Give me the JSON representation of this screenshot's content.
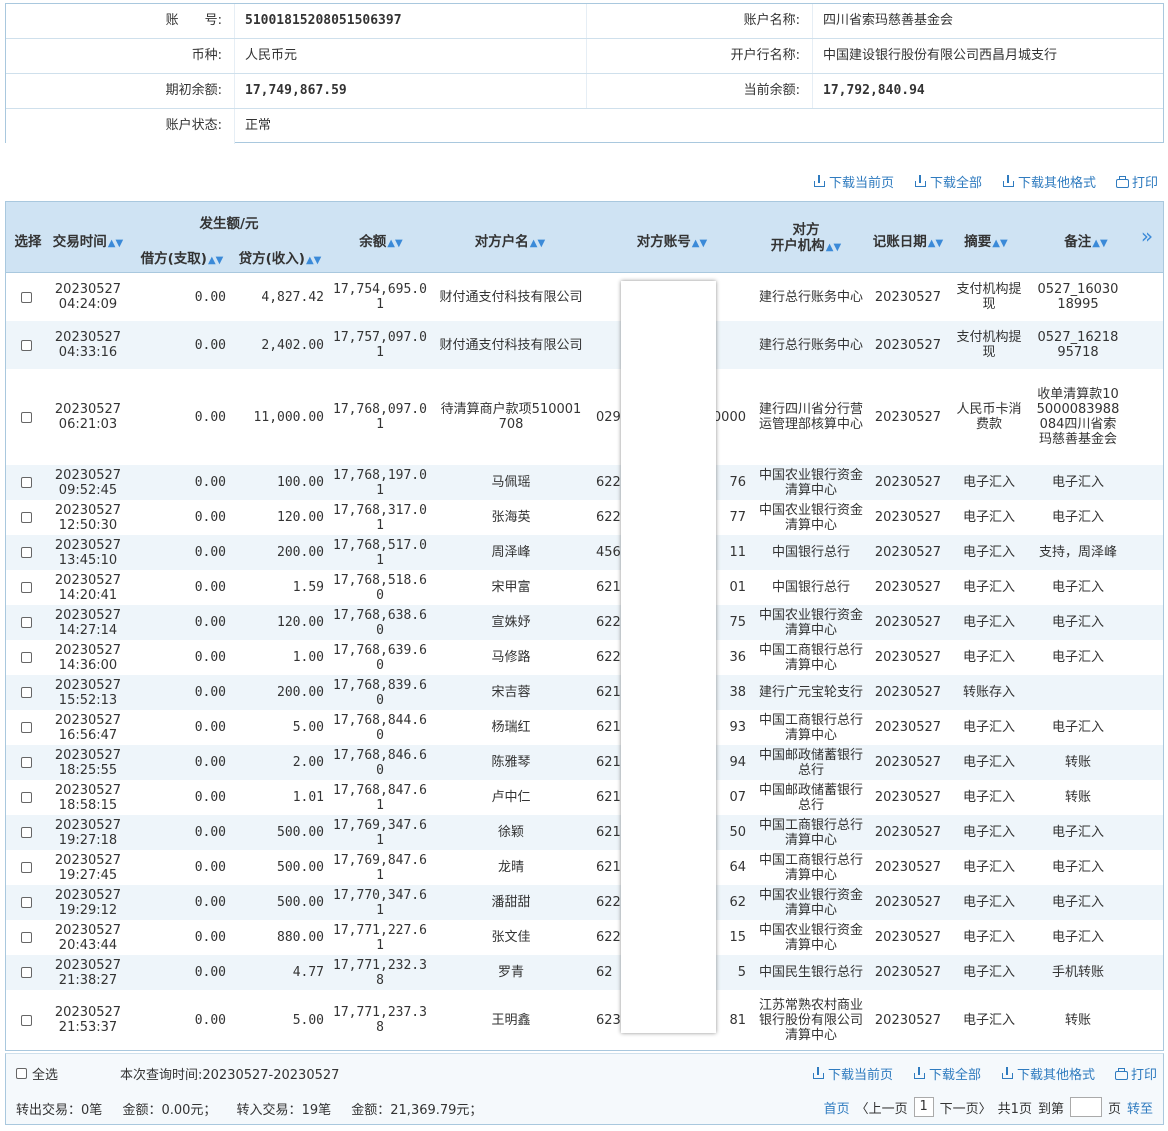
{
  "account": {
    "account_no_label": "账　　号:",
    "account_no": "51001815208051506397",
    "account_name_label": "账户名称:",
    "account_name": "四川省索玛慈善基金会",
    "currency_label": "币种:",
    "currency": "人民币元",
    "bank_label": "开户行名称:",
    "bank": "中国建设银行股份有限公司西昌月城支行",
    "opening_balance_label": "期初余额:",
    "opening_balance": "17,749,867.59",
    "current_balance_label": "当前余额:",
    "current_balance": "17,792,840.94",
    "status_label": "账户状态:",
    "status": "正常"
  },
  "toolbar": {
    "download_page": "下载当前页",
    "download_all": "下载全部",
    "download_other": "下载其他格式",
    "print": "打印"
  },
  "table": {
    "headers": {
      "select": "选择",
      "time": "交易时间",
      "amount_group": "发生额/元",
      "debit": "借方(支取)",
      "credit": "贷方(收入)",
      "balance": "余额",
      "counterparty_name": "对方户名",
      "counterparty_account": "对方账号",
      "counterparty_bank_l1": "对方",
      "counterparty_bank_l2": "开户机构",
      "post_date": "记账日期",
      "summary": "摘要",
      "remark": "备注",
      "more": "»"
    },
    "rows": [
      {
        "date": "20230527",
        "time": "04:24:09",
        "debit": "0.00",
        "credit": "4,827.42",
        "balance": "17,754,695.01",
        "name": "财付通支付科技有限公司",
        "acct_l": "",
        "acct_r": "",
        "bank": "建行总行账务中心",
        "post": "20230527",
        "summary": "支付机构提现",
        "remark": "0527_1603018995"
      },
      {
        "date": "20230527",
        "time": "04:33:16",
        "debit": "0.00",
        "credit": "2,402.00",
        "balance": "17,757,097.01",
        "name": "财付通支付科技有限公司",
        "acct_l": "",
        "acct_r": "",
        "bank": "建行总行账务中心",
        "post": "20230527",
        "summary": "支付机构提现",
        "remark": "0527_1621895718"
      },
      {
        "date": "20230527",
        "time": "06:21:03",
        "debit": "0.00",
        "credit": "11,000.00",
        "balance": "17,768,097.01",
        "name": "待清算商户款项510001708",
        "acct_l": "029",
        "acct_r": "0000",
        "bank": "建行四川省分行营运管理部核算中心",
        "post": "20230527",
        "summary": "人民币卡消费款",
        "remark": "收单清算款105000083988084四川省索玛慈善基金会"
      },
      {
        "date": "20230527",
        "time": "09:52:45",
        "debit": "0.00",
        "credit": "100.00",
        "balance": "17,768,197.01",
        "name": "马佩瑶",
        "acct_l": "6228",
        "acct_r": "76",
        "bank": "中国农业银行资金清算中心",
        "post": "20230527",
        "summary": "电子汇入",
        "remark": "电子汇入"
      },
      {
        "date": "20230527",
        "time": "12:50:30",
        "debit": "0.00",
        "credit": "120.00",
        "balance": "17,768,317.01",
        "name": "张海英",
        "acct_l": "6228",
        "acct_r": "77",
        "bank": "中国农业银行资金清算中心",
        "post": "20230527",
        "summary": "电子汇入",
        "remark": "电子汇入"
      },
      {
        "date": "20230527",
        "time": "13:45:10",
        "debit": "0.00",
        "credit": "200.00",
        "balance": "17,768,517.01",
        "name": "周泽峰",
        "acct_l": "4563",
        "acct_r": "11",
        "bank": "中国银行总行",
        "post": "20230527",
        "summary": "电子汇入",
        "remark": "支持，周泽峰"
      },
      {
        "date": "20230527",
        "time": "14:20:41",
        "debit": "0.00",
        "credit": "1.59",
        "balance": "17,768,518.60",
        "name": "宋甲富",
        "acct_l": "6217",
        "acct_r": "01",
        "bank": "中国银行总行",
        "post": "20230527",
        "summary": "电子汇入",
        "remark": "电子汇入"
      },
      {
        "date": "20230527",
        "time": "14:27:14",
        "debit": "0.00",
        "credit": "120.00",
        "balance": "17,768,638.60",
        "name": "宣姝妤",
        "acct_l": "6228",
        "acct_r": "75",
        "bank": "中国农业银行资金清算中心",
        "post": "20230527",
        "summary": "电子汇入",
        "remark": "电子汇入"
      },
      {
        "date": "20230527",
        "time": "14:36:00",
        "debit": "0.00",
        "credit": "1.00",
        "balance": "17,768,639.60",
        "name": "马修路",
        "acct_l": "6222",
        "acct_r": "36",
        "bank": "中国工商银行总行清算中心",
        "post": "20230527",
        "summary": "电子汇入",
        "remark": "电子汇入"
      },
      {
        "date": "20230527",
        "time": "15:52:13",
        "debit": "0.00",
        "credit": "200.00",
        "balance": "17,768,839.60",
        "name": "宋吉蓉",
        "acct_l": "6217",
        "acct_r": "38",
        "bank": "建行广元宝轮支行",
        "post": "20230527",
        "summary": "转账存入",
        "remark": ""
      },
      {
        "date": "20230527",
        "time": "16:56:47",
        "debit": "0.00",
        "credit": "5.00",
        "balance": "17,768,844.60",
        "name": "杨瑞红",
        "acct_l": "6212",
        "acct_r": "93",
        "bank": "中国工商银行总行清算中心",
        "post": "20230527",
        "summary": "电子汇入",
        "remark": "电子汇入"
      },
      {
        "date": "20230527",
        "time": "18:25:55",
        "debit": "0.00",
        "credit": "2.00",
        "balance": "17,768,846.60",
        "name": "陈雅琴",
        "acct_l": "6217",
        "acct_r": "94",
        "bank": "中国邮政储蓄银行总行",
        "post": "20230527",
        "summary": "电子汇入",
        "remark": "转账"
      },
      {
        "date": "20230527",
        "time": "18:58:15",
        "debit": "0.00",
        "credit": "1.01",
        "balance": "17,768,847.61",
        "name": "卢中仁",
        "acct_l": "6217",
        "acct_r": "07",
        "bank": "中国邮政储蓄银行总行",
        "post": "20230527",
        "summary": "电子汇入",
        "remark": "转账"
      },
      {
        "date": "20230527",
        "time": "19:27:18",
        "debit": "0.00",
        "credit": "500.00",
        "balance": "17,769,347.61",
        "name": "徐颖",
        "acct_l": "6212",
        "acct_r": "50",
        "bank": "中国工商银行总行清算中心",
        "post": "20230527",
        "summary": "电子汇入",
        "remark": "电子汇入"
      },
      {
        "date": "20230527",
        "time": "19:27:45",
        "debit": "0.00",
        "credit": "500.00",
        "balance": "17,769,847.61",
        "name": "龙晴",
        "acct_l": "6212",
        "acct_r": "64",
        "bank": "中国工商银行总行清算中心",
        "post": "20230527",
        "summary": "电子汇入",
        "remark": "电子汇入"
      },
      {
        "date": "20230527",
        "time": "19:29:12",
        "debit": "0.00",
        "credit": "500.00",
        "balance": "17,770,347.61",
        "name": "潘甜甜",
        "acct_l": "6228",
        "acct_r": "62",
        "bank": "中国农业银行资金清算中心",
        "post": "20230527",
        "summary": "电子汇入",
        "remark": "电子汇入"
      },
      {
        "date": "20230527",
        "time": "20:43:44",
        "debit": "0.00",
        "credit": "880.00",
        "balance": "17,771,227.61",
        "name": "张文佳",
        "acct_l": "6228",
        "acct_r": "15",
        "bank": "中国农业银行资金清算中心",
        "post": "20230527",
        "summary": "电子汇入",
        "remark": "电子汇入"
      },
      {
        "date": "20230527",
        "time": "21:38:27",
        "debit": "0.00",
        "credit": "4.77",
        "balance": "17,771,232.38",
        "name": "罗青",
        "acct_l": "62",
        "acct_r": "5",
        "bank": "中国民生银行总行",
        "post": "20230527",
        "summary": "电子汇入",
        "remark": "手机转账"
      },
      {
        "date": "20230527",
        "time": "21:53:37",
        "debit": "0.00",
        "credit": "5.00",
        "balance": "17,771,237.38",
        "name": "王明鑫",
        "acct_l": "6230",
        "acct_r": "81",
        "bank": "江苏常熟农村商业银行股份有限公司清算中心",
        "post": "20230527",
        "summary": "电子汇入",
        "remark": "转账"
      }
    ]
  },
  "footer": {
    "select_all": "全选",
    "query_range": "本次查询时间:20230527-20230527",
    "out_label": "转出交易：",
    "out_count": "0笔",
    "out_amount_label": "金额：",
    "out_amount": "0.00元；",
    "in_label": "转入交易：",
    "in_count": "19笔",
    "in_amount_label": "金额：",
    "in_amount": "21,369.79元；",
    "first": "首页",
    "prev": "〈上一页",
    "page": "1",
    "next": "下一页〉",
    "total": "共1页",
    "goto_label": "到第",
    "goto_unit": "页",
    "goto_btn": "转至"
  }
}
